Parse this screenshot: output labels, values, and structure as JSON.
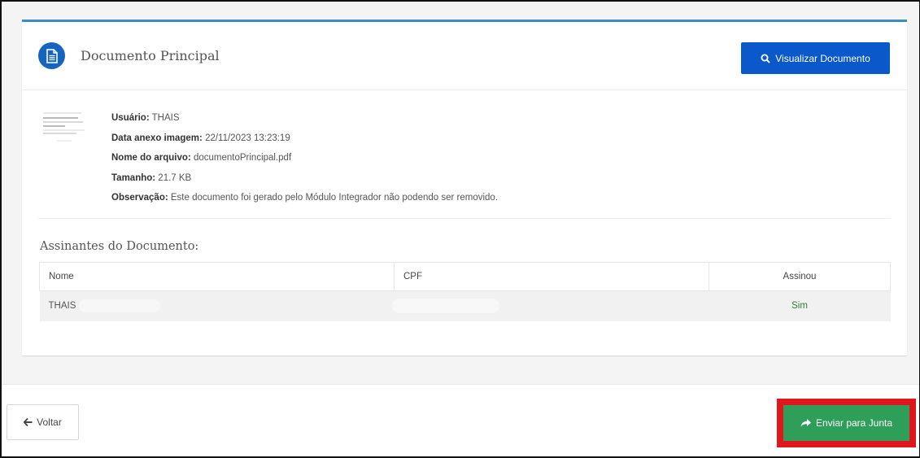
{
  "document": {
    "title": "Documento Principal",
    "view_button_label": "Visualizar Documento",
    "icon": "document-icon"
  },
  "info": {
    "user_label": "Usuário:",
    "user_value": "THAIS",
    "date_label": "Data anexo imagem:",
    "date_value": "22/11/2023 13:23:19",
    "filename_label": "Nome do arquivo:",
    "filename_value": "documentoPrincipal.pdf",
    "size_label": "Tamanho:",
    "size_value": "21.7 KB",
    "note_label": "Observação:",
    "note_value": "Este documento foi gerado pelo Módulo Integrador não podendo ser removido."
  },
  "signers": {
    "title": "Assinantes do Documento:",
    "columns": [
      "Nome",
      "CPF",
      "Assinou"
    ],
    "rows": [
      {
        "name": "THAIS",
        "cpf": "",
        "signed": "Sim"
      }
    ]
  },
  "footer": {
    "back_label": "Voltar",
    "send_label": "Enviar para Junta"
  },
  "colors": {
    "primary": "#0a58ca",
    "success": "#2e9e58",
    "highlight": "#e0161e",
    "card_accent": "#3c8dbc"
  }
}
